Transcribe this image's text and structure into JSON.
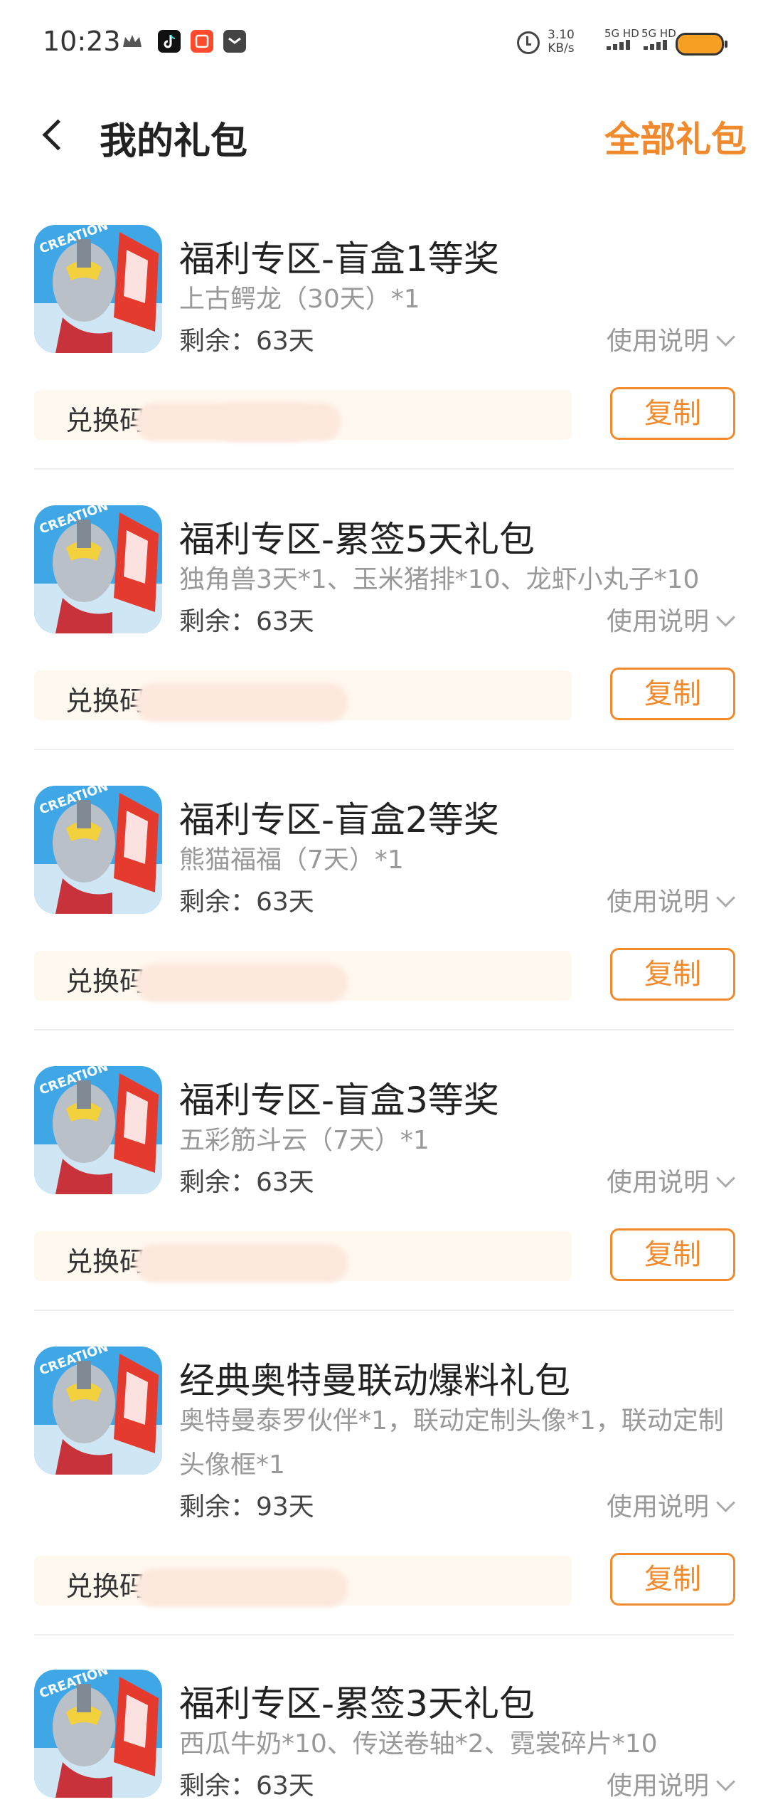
{
  "status_bar": {
    "time": "10:23",
    "net_speed_value": "3.10",
    "net_speed_unit": "KB/s",
    "sim1": "5G HD",
    "sim2": "5G HD",
    "icons": [
      "crown-icon",
      "tiktok-icon",
      "taobao-icon",
      "message-icon",
      "alarm-icon",
      "signal-icon",
      "battery-icon"
    ]
  },
  "header": {
    "title": "我的礼包",
    "all_gifts": "全部礼包"
  },
  "labels": {
    "code_prefix": "兑换码：",
    "copy": "复制",
    "usage": "使用说明"
  },
  "gifts": [
    {
      "name": "福利专区-盲盒1等奖",
      "desc": "上古鳄龙（30天）*1",
      "remaining": "剩余：63天",
      "code_label": "兑换码"
    },
    {
      "name": "福利专区-累签5天礼包",
      "desc": "独角兽3天*1、玉米猪排*10、龙虾小丸子*10",
      "remaining": "剩余：63天",
      "code_label": "兑换码："
    },
    {
      "name": "福利专区-盲盒2等奖",
      "desc": "熊猫福福（7天）*1",
      "remaining": "剩余：63天",
      "code_label": "兑换码"
    },
    {
      "name": "福利专区-盲盒3等奖",
      "desc": "五彩筋斗云（7天）*1",
      "remaining": "剩余：63天",
      "code_label": "兑换码"
    },
    {
      "name": "经典奥特曼联动爆料礼包",
      "desc": "奥特曼泰罗伙伴*1，联动定制头像*1，联动定制头像框*1",
      "remaining": "剩余：93天",
      "code_label": "兑换码"
    },
    {
      "name": "福利专区-累签3天礼包",
      "desc": "西瓜牛奶*10、传送卷轴*2、霓裳碎片*10",
      "remaining": "剩余：63天"
    }
  ],
  "colors": {
    "accent": "#f08a2c",
    "code_bg": "#fff8ee"
  }
}
